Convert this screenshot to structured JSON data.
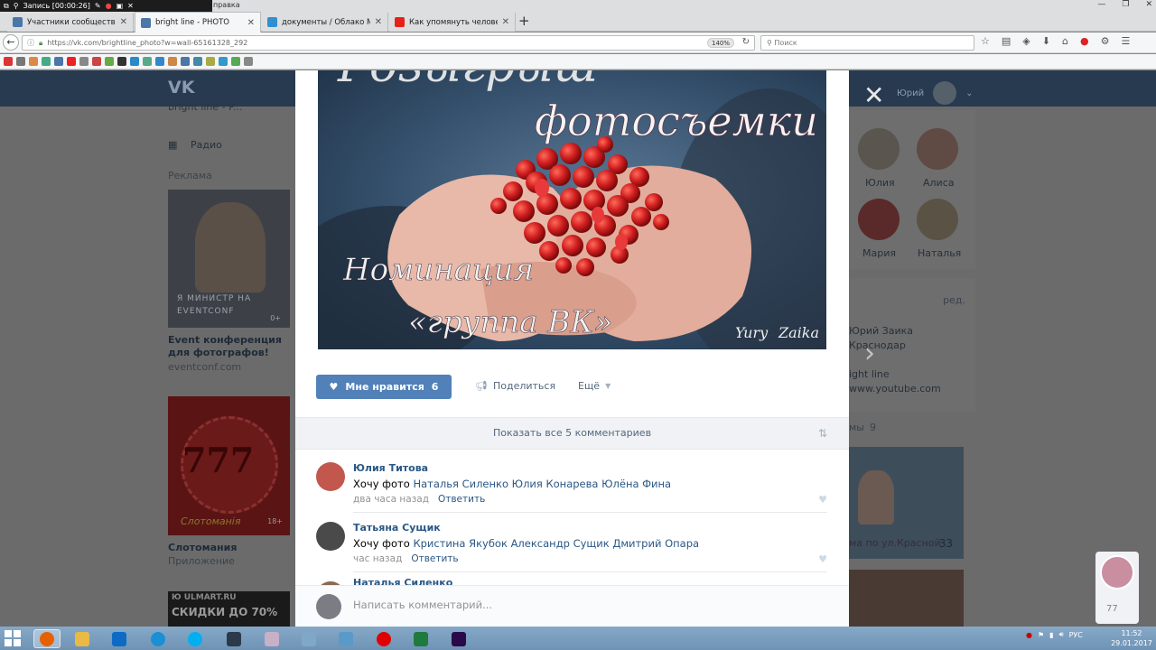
{
  "recorder": {
    "label": "Запись [00:00:26]"
  },
  "menu_fragment": "правка",
  "tabs": [
    {
      "title": "Участники сообщества b...",
      "color": "#4a76a8",
      "active": false
    },
    {
      "title": "bright line - PHOTO",
      "color": "#4a76a8",
      "active": true
    },
    {
      "title": "документы / Облако Mai...",
      "color": "#2f8fd1",
      "active": false
    },
    {
      "title": "Как упомянуть человека ...",
      "color": "#e62117",
      "active": false
    }
  ],
  "browser": {
    "url": "https://vk.com/brightline_photo?w=wall-65161328_292",
    "zoom": "140%",
    "search_placeholder": "Поиск"
  },
  "vk": {
    "user_name": "Юрий",
    "left": {
      "top_partial": "bright line - P...",
      "radio": "Радио",
      "ads_header": "Реклама",
      "ad1_overlay": "Я МИНИСТР НА EVENTCONF",
      "ad1_age": "0+",
      "ad1_title": "Event конференция для фотографов!",
      "ad1_domain": "eventconf.com",
      "ad2_logo": "Слотоманія",
      "ad2_age": "18+",
      "ad2_title": "Слотомания",
      "ad2_sub": "Приложение",
      "ad3_line1": "Ю ULMART.RU",
      "ad3_line2": "СКИДКИ ДО 70%"
    },
    "right": {
      "friends": [
        {
          "name": "Юлия",
          "color": "#7a6a5a"
        },
        {
          "name": "Алиса",
          "color": "#8a5a4a"
        },
        {
          "name": "Мария",
          "color": "#8a2a2a"
        },
        {
          "name": "Наталья",
          "color": "#7a6a52"
        }
      ],
      "link_label": "ред.",
      "owner_line1": "Юрий Заика",
      "owner_line2": "Краснодар",
      "owner_line3": "ight line",
      "owner_line4": "www.youtube.com",
      "albums_label": "мы",
      "albums_count": "9",
      "album_caption": "ма по ул.Красной",
      "album_count": "33"
    }
  },
  "post": {
    "photo_text": {
      "line_top": "Розыгрыш",
      "line_mid": "фотосъемки",
      "nomination": "Номинация",
      "group": "«группа ВК»",
      "signature_1": "Yury",
      "signature_2": "Zaika"
    },
    "like_label": "Мне нравится",
    "like_count": "6",
    "share_label": "Поделиться",
    "more_label": "Ещё",
    "show_all": "Показать все 5 комментариев",
    "write_placeholder": "Написать комментарий..."
  },
  "comments": [
    {
      "author": "Юлия Титова",
      "prefix": "Хочу фото ",
      "mentions": "Наталья Силенко Юлия Конарева Юлёна Фина",
      "time": "два часа назад",
      "reply": "Ответить",
      "avatar": "#c2574e"
    },
    {
      "author": "Татьяна Сущик",
      "prefix": "Хочу фото ",
      "mentions": "Кристина Якубок Александр Сущик Дмитрий Опара",
      "time": "час назад",
      "reply": "Ответить",
      "avatar": "#5a5a5a"
    },
    {
      "author": "Наталья Силенко",
      "prefix": "",
      "mentions": "",
      "time": "",
      "reply": "",
      "avatar": "#8a6a52"
    }
  ],
  "notification": {
    "count": "77"
  },
  "taskbar": {
    "apps": [
      {
        "name": "firefox",
        "color": "#e66000",
        "active": true
      },
      {
        "name": "explorer",
        "color": "#e9b945",
        "active": false
      },
      {
        "name": "teamviewer",
        "color": "#0e6bc4",
        "active": false
      },
      {
        "name": "chrome-app",
        "color": "#1a8fd4",
        "active": false
      },
      {
        "name": "skype",
        "color": "#00aff0",
        "active": false
      },
      {
        "name": "lightroom",
        "color": "#2b3a4a",
        "active": false
      },
      {
        "name": "app-pink",
        "color": "#c8b0c8",
        "active": false
      },
      {
        "name": "notepad",
        "color": "#7fa8c8",
        "active": false
      },
      {
        "name": "app-blue",
        "color": "#5a9ac8",
        "active": false
      },
      {
        "name": "recorder",
        "color": "#e00000",
        "active": false
      },
      {
        "name": "excel",
        "color": "#1f7a3e",
        "active": false
      },
      {
        "name": "premiere",
        "color": "#2a0a4a",
        "active": false
      }
    ],
    "tray_lang": "РУС",
    "time": "11:52",
    "date": "29.01.2017"
  }
}
